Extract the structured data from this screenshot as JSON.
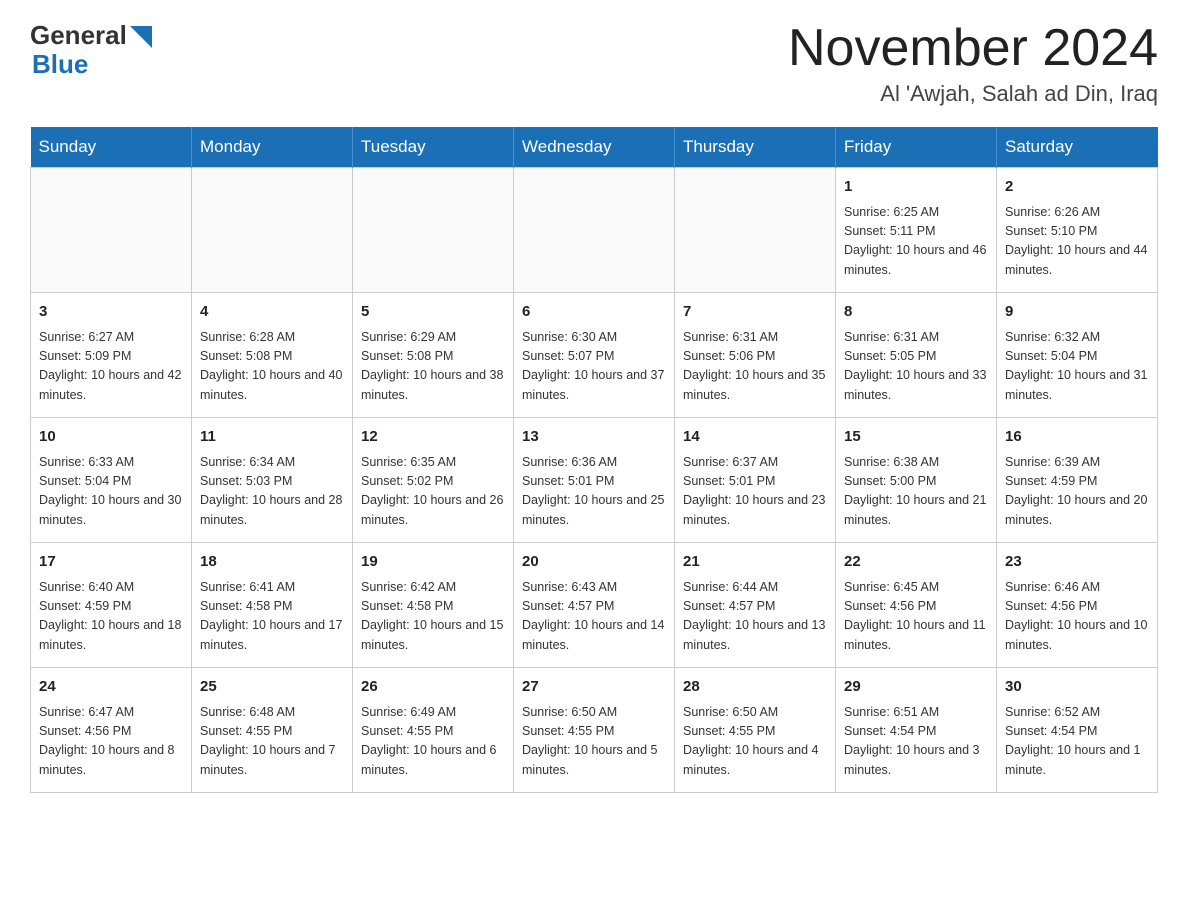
{
  "header": {
    "logo_general": "General",
    "logo_blue": "Blue",
    "month_title": "November 2024",
    "location": "Al 'Awjah, Salah ad Din, Iraq"
  },
  "calendar": {
    "days_of_week": [
      "Sunday",
      "Monday",
      "Tuesday",
      "Wednesday",
      "Thursday",
      "Friday",
      "Saturday"
    ],
    "weeks": [
      [
        {
          "day": "",
          "info": ""
        },
        {
          "day": "",
          "info": ""
        },
        {
          "day": "",
          "info": ""
        },
        {
          "day": "",
          "info": ""
        },
        {
          "day": "",
          "info": ""
        },
        {
          "day": "1",
          "info": "Sunrise: 6:25 AM\nSunset: 5:11 PM\nDaylight: 10 hours and 46 minutes."
        },
        {
          "day": "2",
          "info": "Sunrise: 6:26 AM\nSunset: 5:10 PM\nDaylight: 10 hours and 44 minutes."
        }
      ],
      [
        {
          "day": "3",
          "info": "Sunrise: 6:27 AM\nSunset: 5:09 PM\nDaylight: 10 hours and 42 minutes."
        },
        {
          "day": "4",
          "info": "Sunrise: 6:28 AM\nSunset: 5:08 PM\nDaylight: 10 hours and 40 minutes."
        },
        {
          "day": "5",
          "info": "Sunrise: 6:29 AM\nSunset: 5:08 PM\nDaylight: 10 hours and 38 minutes."
        },
        {
          "day": "6",
          "info": "Sunrise: 6:30 AM\nSunset: 5:07 PM\nDaylight: 10 hours and 37 minutes."
        },
        {
          "day": "7",
          "info": "Sunrise: 6:31 AM\nSunset: 5:06 PM\nDaylight: 10 hours and 35 minutes."
        },
        {
          "day": "8",
          "info": "Sunrise: 6:31 AM\nSunset: 5:05 PM\nDaylight: 10 hours and 33 minutes."
        },
        {
          "day": "9",
          "info": "Sunrise: 6:32 AM\nSunset: 5:04 PM\nDaylight: 10 hours and 31 minutes."
        }
      ],
      [
        {
          "day": "10",
          "info": "Sunrise: 6:33 AM\nSunset: 5:04 PM\nDaylight: 10 hours and 30 minutes."
        },
        {
          "day": "11",
          "info": "Sunrise: 6:34 AM\nSunset: 5:03 PM\nDaylight: 10 hours and 28 minutes."
        },
        {
          "day": "12",
          "info": "Sunrise: 6:35 AM\nSunset: 5:02 PM\nDaylight: 10 hours and 26 minutes."
        },
        {
          "day": "13",
          "info": "Sunrise: 6:36 AM\nSunset: 5:01 PM\nDaylight: 10 hours and 25 minutes."
        },
        {
          "day": "14",
          "info": "Sunrise: 6:37 AM\nSunset: 5:01 PM\nDaylight: 10 hours and 23 minutes."
        },
        {
          "day": "15",
          "info": "Sunrise: 6:38 AM\nSunset: 5:00 PM\nDaylight: 10 hours and 21 minutes."
        },
        {
          "day": "16",
          "info": "Sunrise: 6:39 AM\nSunset: 4:59 PM\nDaylight: 10 hours and 20 minutes."
        }
      ],
      [
        {
          "day": "17",
          "info": "Sunrise: 6:40 AM\nSunset: 4:59 PM\nDaylight: 10 hours and 18 minutes."
        },
        {
          "day": "18",
          "info": "Sunrise: 6:41 AM\nSunset: 4:58 PM\nDaylight: 10 hours and 17 minutes."
        },
        {
          "day": "19",
          "info": "Sunrise: 6:42 AM\nSunset: 4:58 PM\nDaylight: 10 hours and 15 minutes."
        },
        {
          "day": "20",
          "info": "Sunrise: 6:43 AM\nSunset: 4:57 PM\nDaylight: 10 hours and 14 minutes."
        },
        {
          "day": "21",
          "info": "Sunrise: 6:44 AM\nSunset: 4:57 PM\nDaylight: 10 hours and 13 minutes."
        },
        {
          "day": "22",
          "info": "Sunrise: 6:45 AM\nSunset: 4:56 PM\nDaylight: 10 hours and 11 minutes."
        },
        {
          "day": "23",
          "info": "Sunrise: 6:46 AM\nSunset: 4:56 PM\nDaylight: 10 hours and 10 minutes."
        }
      ],
      [
        {
          "day": "24",
          "info": "Sunrise: 6:47 AM\nSunset: 4:56 PM\nDaylight: 10 hours and 8 minutes."
        },
        {
          "day": "25",
          "info": "Sunrise: 6:48 AM\nSunset: 4:55 PM\nDaylight: 10 hours and 7 minutes."
        },
        {
          "day": "26",
          "info": "Sunrise: 6:49 AM\nSunset: 4:55 PM\nDaylight: 10 hours and 6 minutes."
        },
        {
          "day": "27",
          "info": "Sunrise: 6:50 AM\nSunset: 4:55 PM\nDaylight: 10 hours and 5 minutes."
        },
        {
          "day": "28",
          "info": "Sunrise: 6:50 AM\nSunset: 4:55 PM\nDaylight: 10 hours and 4 minutes."
        },
        {
          "day": "29",
          "info": "Sunrise: 6:51 AM\nSunset: 4:54 PM\nDaylight: 10 hours and 3 minutes."
        },
        {
          "day": "30",
          "info": "Sunrise: 6:52 AM\nSunset: 4:54 PM\nDaylight: 10 hours and 1 minute."
        }
      ]
    ]
  }
}
